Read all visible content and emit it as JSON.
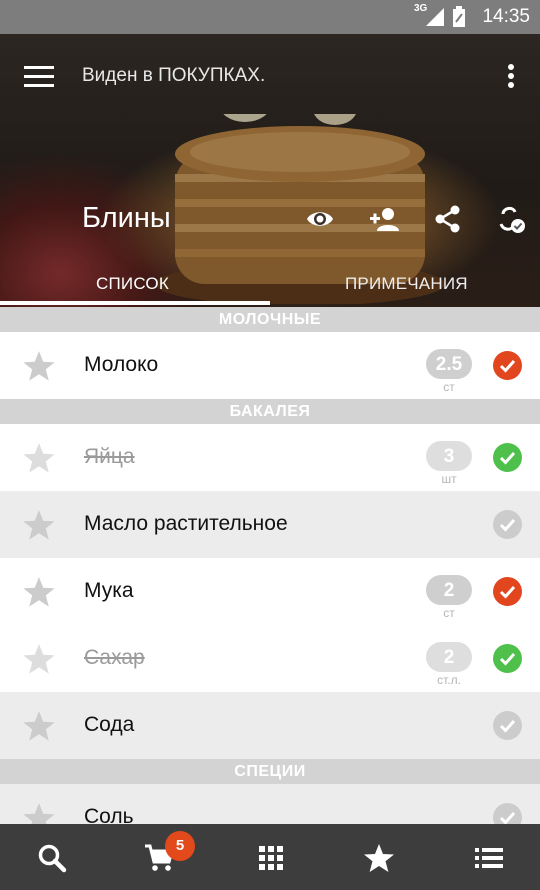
{
  "status_bar": {
    "network": "3G",
    "time": "14:35"
  },
  "header": {
    "visibility_text": "Виден в ПОКУПКАХ.",
    "list_title": "Блины",
    "tabs": [
      "СПИСОК",
      "ПРИМЕЧАНИЯ"
    ],
    "active_tab": "СПИСОК"
  },
  "colors": {
    "checked_orange": "#e2461f",
    "checked_green": "#4fc04b",
    "unchecked_gray": "#cccccc",
    "section_bg": "#d3d3d3"
  },
  "sections": [
    {
      "title": "МОЛОЧНЫЕ",
      "items": [
        {
          "name": "Молоко",
          "qty": "2.5",
          "unit": "ст",
          "status": "orange",
          "struck": false
        }
      ]
    },
    {
      "title": "БАКАЛЕЯ",
      "items": [
        {
          "name": "Яйца",
          "qty": "3",
          "unit": "шт",
          "status": "green",
          "struck": true
        },
        {
          "name": "Масло растительное",
          "qty": "",
          "unit": "",
          "status": "gray",
          "struck": false
        },
        {
          "name": "Мука",
          "qty": "2",
          "unit": "ст",
          "status": "orange",
          "struck": false
        },
        {
          "name": "Сахар",
          "qty": "2",
          "unit": "ст.л.",
          "status": "green",
          "struck": true
        },
        {
          "name": "Сода",
          "qty": "",
          "unit": "",
          "status": "gray",
          "struck": false
        }
      ]
    },
    {
      "title": "СПЕЦИИ",
      "items": [
        {
          "name": "Соль",
          "qty": "",
          "unit": "",
          "status": "gray",
          "struck": false
        }
      ]
    }
  ],
  "bottom_nav": {
    "items": [
      "search-icon",
      "cart-icon",
      "grid-icon",
      "star-icon",
      "list-icon"
    ],
    "cart_badge": "5"
  }
}
